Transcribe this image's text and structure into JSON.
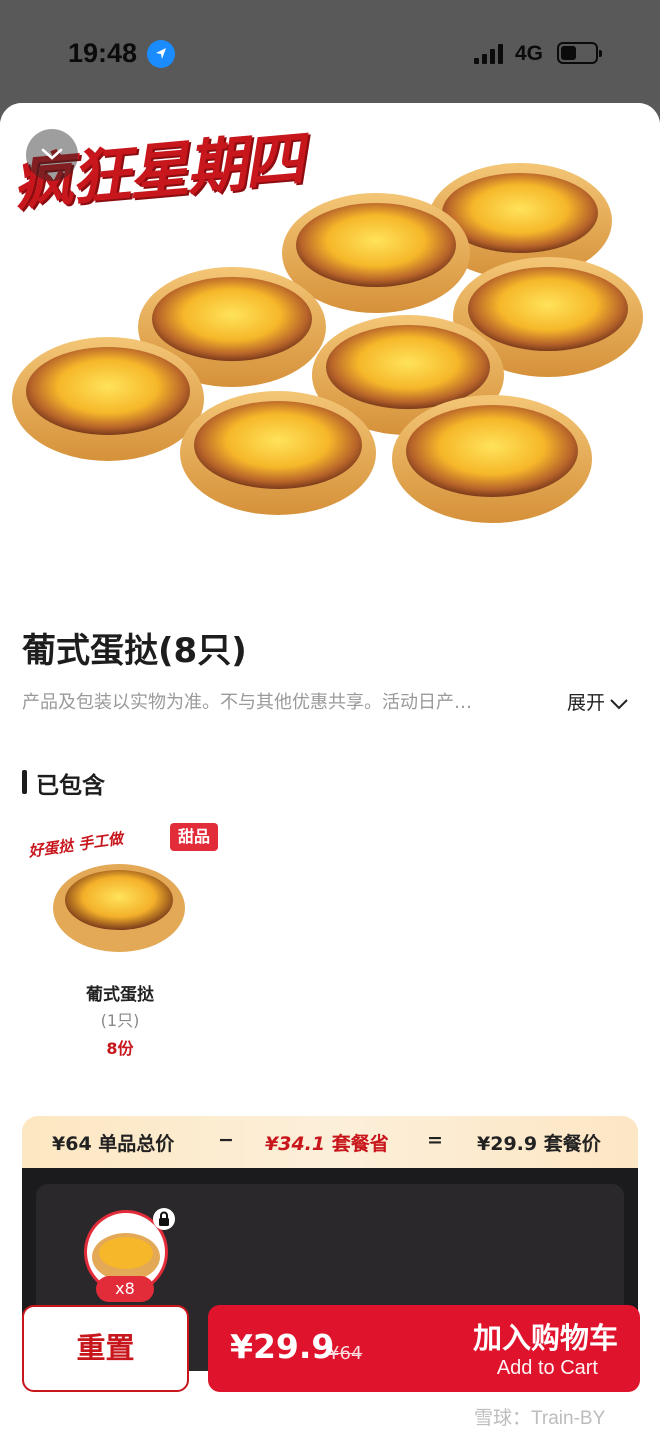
{
  "status_bar": {
    "time": "19:48",
    "network": "4G"
  },
  "hero": {
    "promo_title": "疯狂星期四"
  },
  "product": {
    "title": "葡式蛋挞(8只)",
    "description": "产品及包装以实物为准。不与其他优惠共享。活动日产…",
    "expand_label": "展开"
  },
  "included": {
    "section_title": "已包含",
    "items": [
      {
        "badge": "甜品",
        "handwrite": "好蛋挞 手工做",
        "name": "葡式蛋挞",
        "unit": "(1只)",
        "qty": "8份"
      }
    ]
  },
  "price_summary": {
    "single_total": "¥64 单品总价",
    "minus": "−",
    "save_amount": "¥34.1",
    "save_label": "套餐省",
    "equals": "=",
    "combo_price": "¥29.9 套餐价"
  },
  "selector": {
    "qty_pill": "x8"
  },
  "actions": {
    "reset_label": "重置",
    "cart_price": "¥29.9",
    "cart_orig_price": "¥64",
    "cart_label": "加入购物车",
    "cart_sub": "Add to Cart"
  },
  "watermark": "雪球：Train-BY",
  "colors": {
    "brand_red": "#e0132c",
    "accent_red": "#c8161d"
  }
}
